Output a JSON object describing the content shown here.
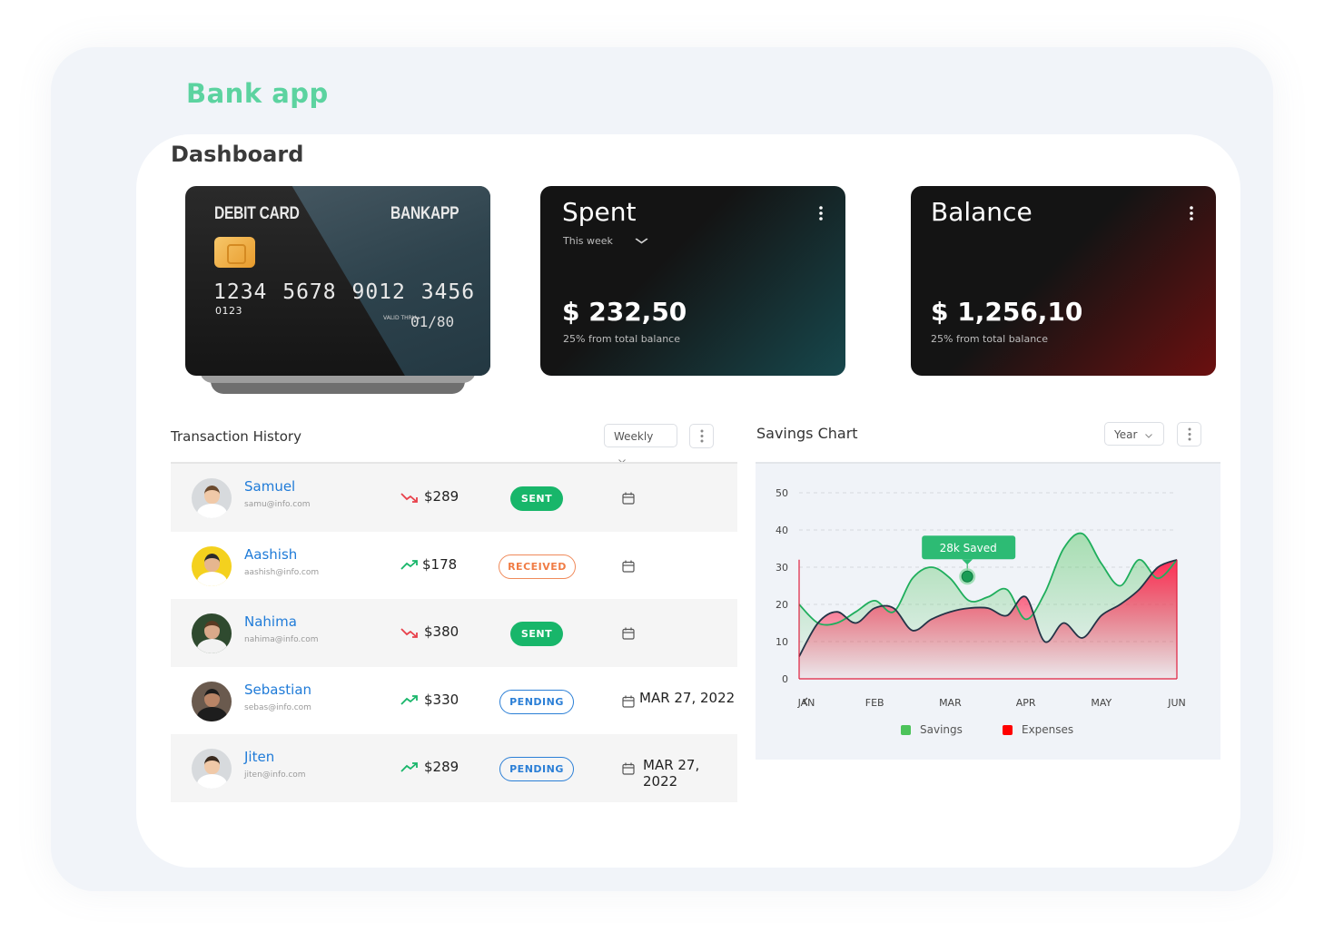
{
  "app_title": "Bank app",
  "page_title": "Dashboard",
  "debit_card": {
    "type_label": "DEBIT CARD",
    "brand_label": "BANKAPP",
    "number": "1234 5678 9012 3456",
    "small_number": "0123",
    "valid_label": "VALID THRU",
    "expiry": "01/80"
  },
  "spent": {
    "title": "Spent",
    "period": "This week",
    "amount": "$ 232,50",
    "note": "25% from total balance"
  },
  "balance": {
    "title": "Balance",
    "amount": "$ 1,256,10",
    "note": "25% from total balance"
  },
  "transactions": {
    "title": "Transaction History",
    "filter": "Weekly",
    "rows": [
      {
        "name": "Samuel",
        "email": "samu@info.com",
        "trend": "down",
        "amount": "$289",
        "status": "SENT",
        "date": ""
      },
      {
        "name": "Aashish",
        "email": "aashish@info.com",
        "trend": "up",
        "amount": "$178",
        "status": "RECEIVED",
        "date": ""
      },
      {
        "name": "Nahima",
        "email": "nahima@info.com",
        "trend": "down",
        "amount": "$380",
        "status": "SENT",
        "date": ""
      },
      {
        "name": "Sebastian",
        "email": "sebas@info.com",
        "trend": "up",
        "amount": "$330",
        "status": "PENDING",
        "date": "MAR 27, 2022"
      },
      {
        "name": "Jiten",
        "email": "jiten@info.com",
        "trend": "up",
        "amount": "$289",
        "status": "PENDING",
        "date": "MAR 27, 2022"
      }
    ]
  },
  "savings": {
    "title": "Savings Chart",
    "filter": "Year",
    "tooltip": "28k Saved"
  },
  "colors": {
    "accent": "#5cd3a0",
    "savings": "#4cc35a",
    "expenses": "#ff0000",
    "link": "#1f7bd8",
    "sent": "#18b66a",
    "received": "#f07c45",
    "pending": "#2b7fd6"
  },
  "chart_data": {
    "type": "area",
    "categories": [
      "JAN",
      "FEB",
      "MAR",
      "APR",
      "MAY",
      "JUN"
    ],
    "ylim": [
      0,
      50
    ],
    "yticks": [
      0,
      10,
      20,
      30,
      40,
      50
    ],
    "grid": true,
    "legend_position": "bottom",
    "series": [
      {
        "name": "Savings",
        "color": "#4cc35a",
        "x": [
          0,
          0.25,
          0.5,
          0.75,
          1,
          1.25,
          1.5,
          1.75,
          2,
          2.25,
          2.5,
          2.75,
          3,
          3.25,
          3.5,
          3.75,
          4,
          4.25,
          4.5,
          4.75,
          5
        ],
        "values": [
          20,
          15,
          15,
          18,
          21,
          18,
          27,
          30,
          27,
          21,
          22,
          24,
          16,
          23,
          35,
          39,
          31,
          25,
          32,
          27,
          32
        ]
      },
      {
        "name": "Expenses",
        "color": "#ff0000",
        "x": [
          0,
          0.25,
          0.5,
          0.75,
          1,
          1.25,
          1.5,
          1.75,
          2,
          2.25,
          2.5,
          2.75,
          3,
          3.25,
          3.5,
          3.75,
          4,
          4.25,
          4.5,
          4.75,
          5
        ],
        "values": [
          6,
          15,
          18,
          15,
          19,
          19,
          13,
          16,
          18,
          19,
          19,
          17,
          22,
          10,
          15,
          11,
          17,
          20,
          24,
          30,
          32
        ]
      }
    ]
  }
}
